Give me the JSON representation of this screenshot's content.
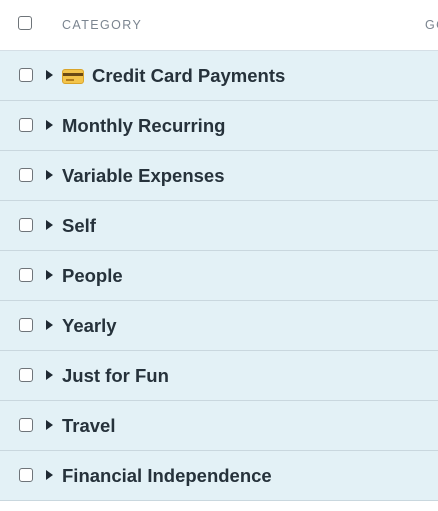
{
  "header": {
    "category_label": "CATEGORY",
    "goal_label": "GO"
  },
  "categories": [
    {
      "label": "Credit Card Payments",
      "icon": "credit-card-icon"
    },
    {
      "label": "Monthly Recurring"
    },
    {
      "label": "Variable Expenses"
    },
    {
      "label": "Self"
    },
    {
      "label": "People"
    },
    {
      "label": "Yearly"
    },
    {
      "label": "Just for Fun"
    },
    {
      "label": "Travel"
    },
    {
      "label": "Financial Independence"
    }
  ],
  "colors": {
    "row_background": "#e3f1f6",
    "text": "#26323b",
    "header_text": "#7b8590"
  }
}
